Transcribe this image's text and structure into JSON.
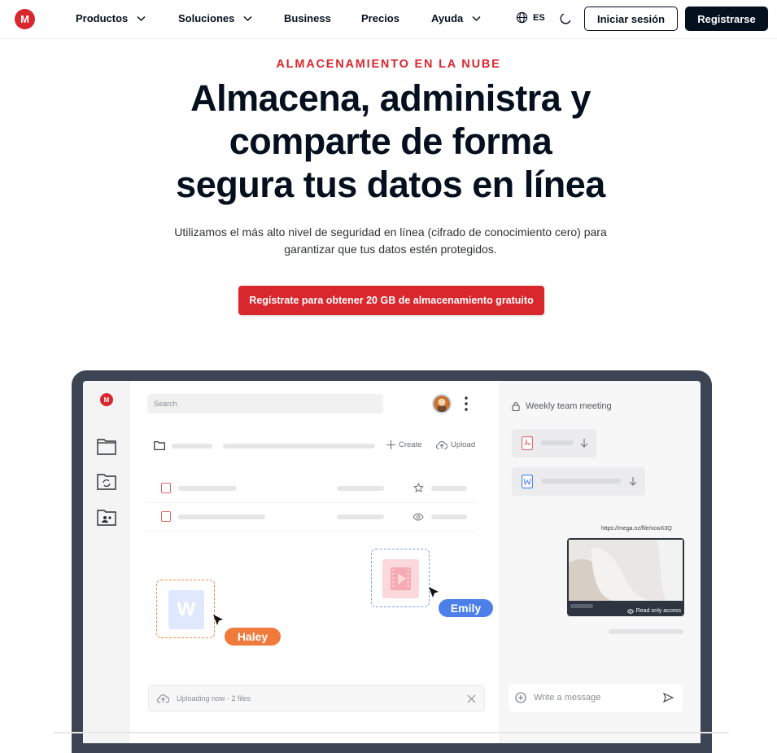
{
  "nav": {
    "logo": "M",
    "items": [
      {
        "label": "Productos",
        "dropdown": true
      },
      {
        "label": "Soluciones",
        "dropdown": true
      },
      {
        "label": "Business",
        "dropdown": false
      },
      {
        "label": "Precios",
        "dropdown": false
      },
      {
        "label": "Ayuda",
        "dropdown": true
      }
    ],
    "language": "ES",
    "login_label": "Iniciar sesión",
    "register_label": "Registrarse"
  },
  "hero": {
    "eyebrow": "ALMACENAMIENTO EN LA NUBE",
    "title_line1": "Almacena, administra y",
    "title_line2": "comparte de forma",
    "title_line3": "segura tus datos en línea",
    "subtitle_line1": "Utilizamos el más alto nivel de seguridad en línea (cifrado de conocimiento cero) para",
    "subtitle_line2": "garantizar que tus datos estén protegidos.",
    "cta_label": "Regístrate para obtener 20 GB de almacenamiento gratuito"
  },
  "mockup": {
    "logo": "M",
    "search_placeholder": "Search",
    "create_label": "Create",
    "upload_label": "Upload",
    "word_letter": "W",
    "user_haley": "Haley",
    "user_emily": "Emily",
    "upload_status": "Uploading now - 2 files",
    "meeting_title": "Weekly team meeting",
    "share_link": "https://mega.nz/file/vcwX3Q",
    "read_only": "Read only access",
    "message_placeholder": "Write a message"
  },
  "colors": {
    "brand_red": "#d9272e",
    "dark": "#04101e",
    "haley_tag": "#f07a3c",
    "emily_tag": "#4d7fe8"
  }
}
